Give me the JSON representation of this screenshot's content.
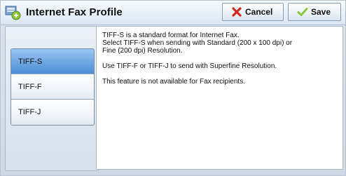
{
  "header": {
    "title": "Internet Fax Profile",
    "cancel_label": "Cancel",
    "save_label": "Save"
  },
  "options": [
    {
      "label": "TIFF-S",
      "selected": true
    },
    {
      "label": "TIFF-F",
      "selected": false
    },
    {
      "label": "TIFF-J",
      "selected": false
    }
  ],
  "info": {
    "p1_l1": "TIFF-S is a standard format for Internet Fax.",
    "p1_l2": "Select TIFF-S when sending with Standard (200 x 100 dpi) or",
    "p1_l3": "Fine (200 dpi) Resolution.",
    "p2": "Use TIFF-F or TIFF-J to send with Superfine Resolution.",
    "p3": "This feature is not available for Fax recipients."
  },
  "colors": {
    "selected": "#6fa6e2",
    "cancel_icon": "#d32a1e",
    "save_icon": "#8cc63f"
  }
}
